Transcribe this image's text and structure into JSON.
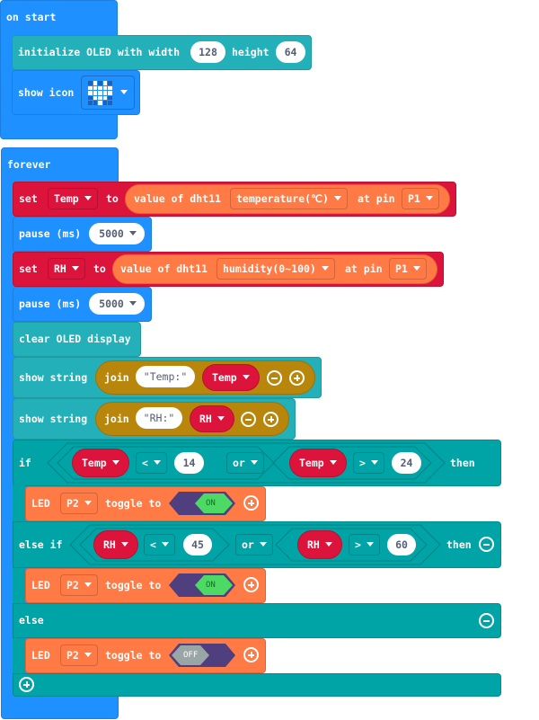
{
  "on_start": {
    "label": "on start",
    "init_oled": {
      "label": "initialize OLED with width",
      "width_value": "128",
      "height_label": "height",
      "height_value": "64"
    },
    "show_icon": {
      "label": "show icon",
      "icon": "heart-icon",
      "pattern": [
        [
          0,
          1,
          0,
          1,
          0
        ],
        [
          1,
          1,
          1,
          1,
          1
        ],
        [
          1,
          1,
          1,
          1,
          1
        ],
        [
          0,
          1,
          1,
          1,
          0
        ],
        [
          0,
          0,
          1,
          0,
          0
        ]
      ]
    }
  },
  "forever": {
    "label": "forever",
    "set_temp": {
      "set_label": "set",
      "variable": "Temp",
      "to_label": "to",
      "value_of": "value of dht11",
      "sensor": "temperature(℃)",
      "at_pin_label": "at pin",
      "pin": "P1"
    },
    "pause1": {
      "label": "pause (ms)",
      "value": "5000"
    },
    "set_rh": {
      "set_label": "set",
      "variable": "RH",
      "to_label": "to",
      "value_of": "value of dht11",
      "sensor": "humidity(0~100)",
      "at_pin_label": "at pin",
      "pin": "P1"
    },
    "pause2": {
      "label": "pause (ms)",
      "value": "5000"
    },
    "clear_oled": {
      "label": "clear OLED display"
    },
    "show_string1": {
      "label": "show string",
      "join_label": "join",
      "text": "Temp:",
      "variable": "Temp"
    },
    "show_string2": {
      "label": "show string",
      "join_label": "join",
      "text": "RH:",
      "variable": "RH"
    },
    "if_block": {
      "if_label": "if",
      "cond1": {
        "variable": "Temp",
        "op": "<",
        "value": "14"
      },
      "logic": "or",
      "cond2": {
        "variable": "Temp",
        "op": ">",
        "value": "24"
      },
      "then_label": "then",
      "led": {
        "label": "LED",
        "pin": "P2",
        "toggle_label": "toggle to",
        "state": "ON"
      }
    },
    "else_if_block": {
      "label": "else if",
      "cond1": {
        "variable": "RH",
        "op": "<",
        "value": "45"
      },
      "logic": "or",
      "cond2": {
        "variable": "RH",
        "op": ">",
        "value": "60"
      },
      "then_label": "then",
      "led": {
        "label": "LED",
        "pin": "P2",
        "toggle_label": "toggle to",
        "state": "ON"
      }
    },
    "else_block": {
      "label": "else",
      "led": {
        "label": "LED",
        "pin": "P2",
        "toggle_label": "toggle to",
        "state": "OFF"
      }
    }
  },
  "colors": {
    "basic": "#1e90ff",
    "oled": "#24b0b8",
    "logic": "#00a4a6",
    "variables": "#dc143c",
    "dht": "#ff7a45",
    "text": "#b8860b",
    "toggle_on": "#4cd964",
    "toggle_off": "#9aa5a5",
    "toggle_track": "#4f3f7f"
  }
}
